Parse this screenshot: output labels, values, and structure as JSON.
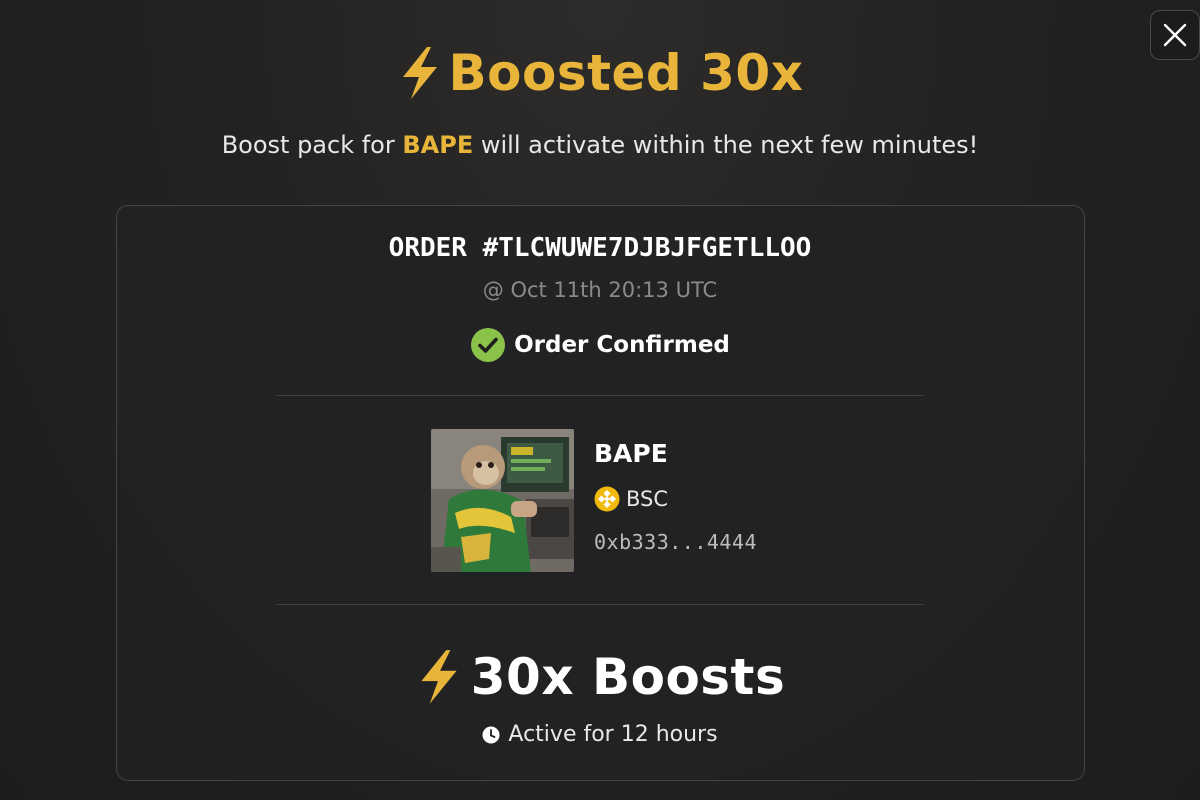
{
  "header": {
    "title": "Boosted 30x",
    "icon": "lightning-bolt-icon",
    "accent_color": "#e8b53a"
  },
  "subtitle": {
    "prefix": "Boost pack for ",
    "token": "BAPE",
    "suffix": " will activate within the next few minutes!"
  },
  "order": {
    "id_text": "ORDER #TLCWUWE7DJBJFGETLLOO",
    "timestamp": "@ Oct 11th 20:13 UTC",
    "status": "Order Confirmed",
    "status_color": "#8bc34a"
  },
  "token": {
    "name": "BAPE",
    "chain": "BSC",
    "chain_icon": "bnb-chain-icon",
    "address": "0xb333...4444",
    "image_icon": "monkey-token-image"
  },
  "boost": {
    "label": "30x Boosts",
    "duration": "Active for 12 hours",
    "duration_icon": "clock-icon"
  },
  "close": {
    "icon": "close-icon"
  }
}
